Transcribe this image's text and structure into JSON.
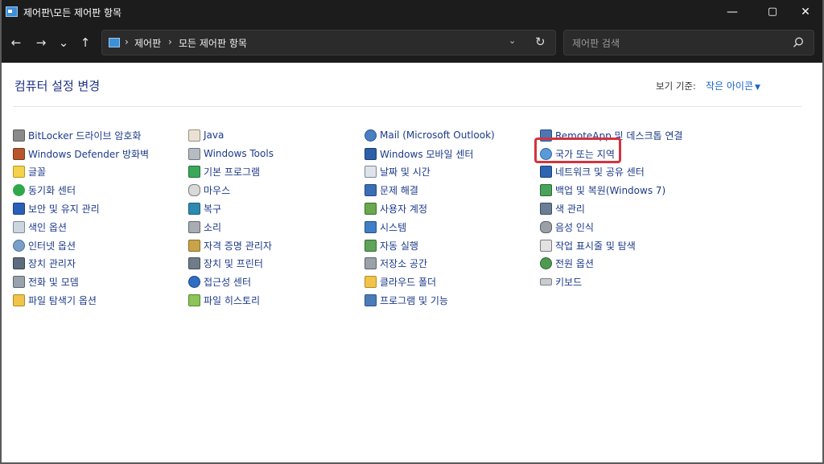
{
  "window": {
    "title": "제어판\\모든 제어판 항목",
    "minimize": "—",
    "maximize": "▢",
    "close": "✕"
  },
  "nav": {
    "back": "←",
    "forward": "→",
    "recent": "⌄",
    "up": "↑"
  },
  "address": {
    "crumbs": [
      "제어판",
      "모든 제어판 항목"
    ],
    "separator": "›",
    "dropdown": "⌄",
    "refresh": "↻"
  },
  "search": {
    "placeholder": "제어판 검색"
  },
  "main": {
    "heading": "컴퓨터 설정 변경",
    "view_by_label": "보기 기준:",
    "view_by_value": "작은 아이콘",
    "view_by_arrow": "▼"
  },
  "items": {
    "col1": [
      "BitLocker 드라이브 암호화",
      "Windows Defender 방화벽",
      "글꼴",
      "동기화 센터",
      "보안 및 유지 관리",
      "색인 옵션",
      "인터넷 옵션",
      "장치 관리자",
      "전화 및 모뎀",
      "파일 탐색기 옵션"
    ],
    "col2": [
      "Java",
      "Windows Tools",
      "기본 프로그램",
      "마우스",
      "복구",
      "소리",
      "자격 증명 관리자",
      "장치 및 프린터",
      "접근성 센터",
      "파일 히스토리"
    ],
    "col3": [
      "Mail (Microsoft Outlook)",
      "Windows 모바일 센터",
      "날짜 및 시간",
      "문제 해결",
      "사용자 계정",
      "시스템",
      "자동 실행",
      "저장소 공간",
      "클라우드 폴더",
      "프로그램 및 기능"
    ],
    "col4": [
      "RemoteApp 및 데스크톱 연결",
      "국가 또는 지역",
      "네트워크 및 공유 센터",
      "백업 및 복원(Windows 7)",
      "색 관리",
      "음성 인식",
      "작업 표시줄 및 탐색",
      "전원 옵션",
      "키보드"
    ]
  },
  "colors": {
    "titlebar": "#1c1c1c",
    "link": "#1c3a8a",
    "heading": "#1e3287",
    "accent": "#1a64c8",
    "highlight": "#d4333f"
  }
}
